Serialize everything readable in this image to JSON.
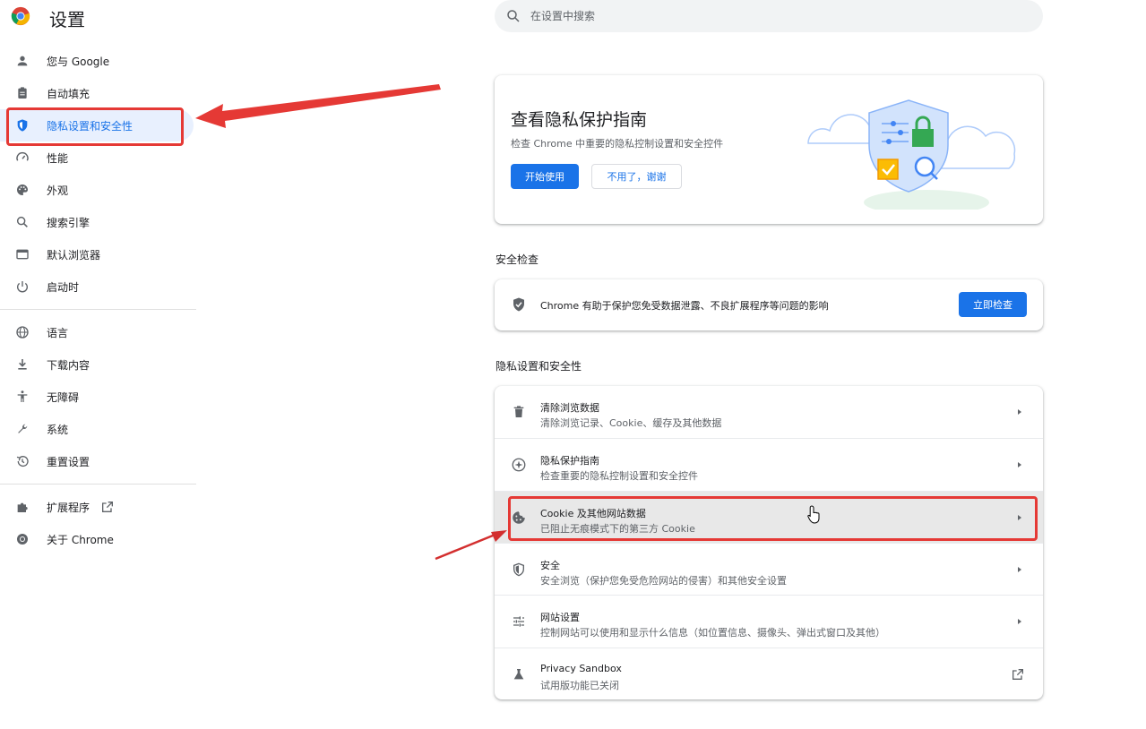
{
  "header": {
    "title": "设置",
    "search_placeholder": "在设置中搜索"
  },
  "sidebar": {
    "items": [
      {
        "label": "您与 Google",
        "icon": "person-icon"
      },
      {
        "label": "自动填充",
        "icon": "clipboard-icon"
      },
      {
        "label": "隐私设置和安全性",
        "icon": "shield-icon",
        "active": true
      },
      {
        "label": "性能",
        "icon": "speedometer-icon"
      },
      {
        "label": "外观",
        "icon": "palette-icon"
      },
      {
        "label": "搜索引擎",
        "icon": "search-icon"
      },
      {
        "label": "默认浏览器",
        "icon": "browser-window-icon"
      },
      {
        "label": "启动时",
        "icon": "power-icon"
      },
      {
        "label": "语言",
        "icon": "globe-icon"
      },
      {
        "label": "下载内容",
        "icon": "download-icon"
      },
      {
        "label": "无障碍",
        "icon": "accessibility-icon"
      },
      {
        "label": "系统",
        "icon": "wrench-icon"
      },
      {
        "label": "重置设置",
        "icon": "history-icon"
      },
      {
        "label": "扩展程序",
        "icon": "puzzle-icon"
      },
      {
        "label": "关于 Chrome",
        "icon": "chrome-icon"
      }
    ]
  },
  "guide_card": {
    "title": "查看隐私保护指南",
    "subtitle": "检查 Chrome 中重要的隐私控制设置和安全控件",
    "start_button": "开始使用",
    "dismiss_button": "不用了，谢谢"
  },
  "safety_check": {
    "section_title": "安全检查",
    "text": "Chrome 有助于保护您免受数据泄露、不良扩展程序等问题的影响",
    "button": "立即检查"
  },
  "privacy": {
    "section_title": "隐私设置和安全性",
    "rows": [
      {
        "title": "清除浏览数据",
        "subtitle": "清除浏览记录、Cookie、缓存及其他数据",
        "icon": "trash-icon"
      },
      {
        "title": "隐私保护指南",
        "subtitle": "检查重要的隐私控制设置和安全控件",
        "icon": "compass-icon"
      },
      {
        "title": "Cookie 及其他网站数据",
        "subtitle": "已阻止无痕模式下的第三方 Cookie",
        "icon": "cookie-icon"
      },
      {
        "title": "安全",
        "subtitle": "安全浏览（保护您免受危险网站的侵害）和其他安全设置",
        "icon": "security-shield-icon"
      },
      {
        "title": "网站设置",
        "subtitle": "控制网站可以使用和显示什么信息（如位置信息、摄像头、弹出式窗口及其他）",
        "icon": "tune-icon"
      },
      {
        "title": "Privacy Sandbox",
        "subtitle": "试用版功能已关闭",
        "icon": "flask-icon"
      }
    ]
  },
  "colors": {
    "accent": "#1a73e8",
    "active_bg": "#e8f0fe",
    "annotation_red": "#e53935"
  }
}
